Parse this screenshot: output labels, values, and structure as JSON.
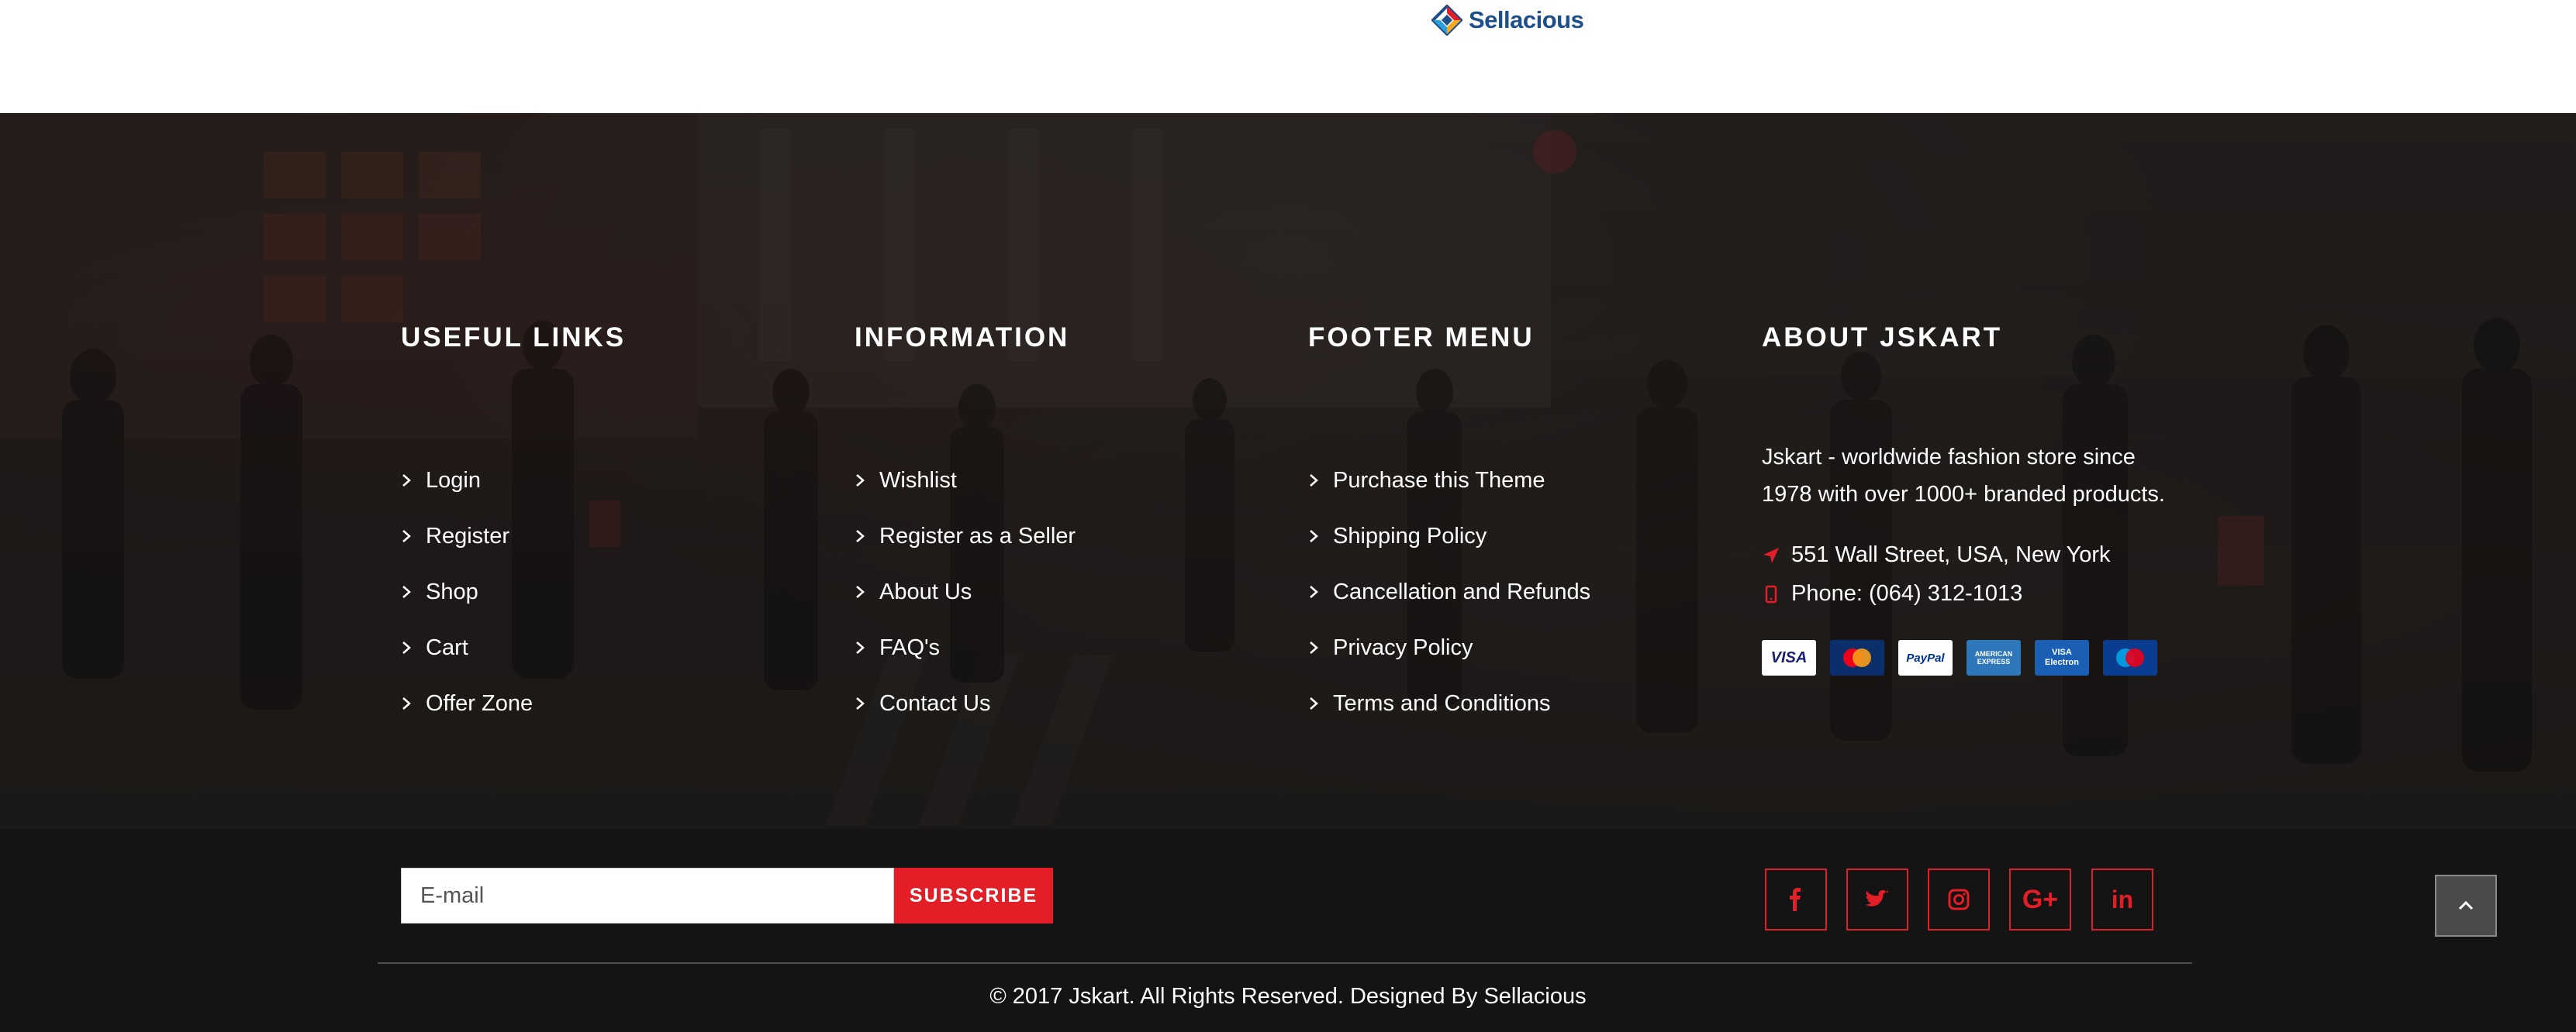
{
  "brand": {
    "logo_text": "Sellacious",
    "logo_colors": [
      "#e41e26",
      "#1d4f8c",
      "#2aa1dc",
      "#f7a823"
    ]
  },
  "footer": {
    "columns": [
      {
        "title": "USEFUL LINKS",
        "links": [
          "Login",
          "Register",
          "Shop",
          "Cart",
          "Offer Zone"
        ]
      },
      {
        "title": "INFORMATION",
        "links": [
          "Wishlist",
          "Register as a Seller",
          "About Us",
          "FAQ's",
          "Contact Us"
        ]
      },
      {
        "title": "FOOTER MENU",
        "links": [
          "Purchase this Theme",
          "Shipping Policy",
          "Cancellation and Refunds",
          "Privacy Policy",
          "Terms and Conditions"
        ]
      }
    ],
    "about": {
      "title": "ABOUT JSKART",
      "line1": "Jskart - worldwide fashion store since",
      "line2": "1978 with over 1000+ branded products.",
      "address": "551 Wall Street, USA, New York",
      "phone": "Phone: (064) 312-1013",
      "payment_methods": [
        {
          "label": "VISA",
          "icon": "visa-card-icon"
        },
        {
          "label": "MasterCard",
          "icon": "mastercard-icon"
        },
        {
          "label": "PayPal",
          "icon": "paypal-icon"
        },
        {
          "label": "AMERICAN EXPRESS",
          "icon": "amex-icon"
        },
        {
          "label": "VISA Electron",
          "icon": "visa-electron-icon"
        },
        {
          "label": "Maestro",
          "icon": "maestro-icon"
        }
      ]
    }
  },
  "newsletter": {
    "placeholder": "E-mail",
    "button_label": "SUBSCRIBE"
  },
  "social": [
    {
      "name": "facebook",
      "glyph": "f"
    },
    {
      "name": "twitter",
      "glyph": "t"
    },
    {
      "name": "instagram",
      "glyph": "i"
    },
    {
      "name": "google-plus",
      "glyph": "G+"
    },
    {
      "name": "linkedin",
      "glyph": "in"
    }
  ],
  "copyright": "© 2017 Jskart. All Rights Reserved. Designed By Sellacious",
  "colors": {
    "accent": "#e41e26",
    "bottom_bar": "#141414",
    "text": "#ffffff"
  }
}
